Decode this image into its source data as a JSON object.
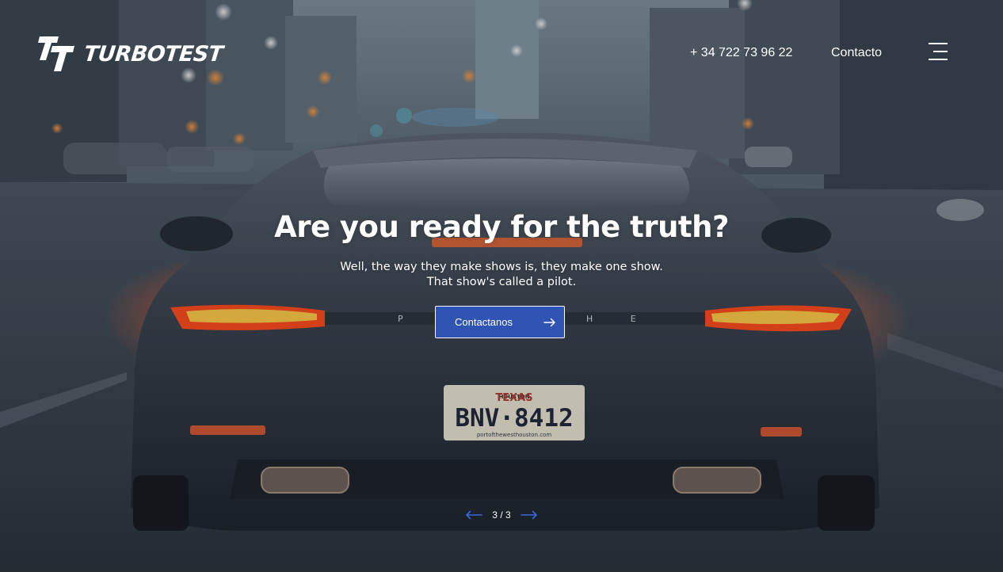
{
  "brand": {
    "name": "TURBOTEST",
    "accent_color": "#2f54b4"
  },
  "header": {
    "phone": "+ 34 722 73 96 22",
    "contact_label": "Contacto",
    "menu_icon": "hamburger-menu-icon"
  },
  "hero": {
    "title": "Are you ready for the truth?",
    "subtitle_line1": "Well, the way they make shows is, they make one show.",
    "subtitle_line2": "That show's called a pilot.",
    "cta_label": "Contactanos",
    "cta_icon": "arrow-right-icon"
  },
  "slider": {
    "current": "3",
    "separator": "/",
    "total": "3",
    "prev_icon": "arrow-left-icon",
    "next_icon": "arrow-right-icon"
  },
  "background_image": {
    "plate_state": "TEXAS",
    "plate_number": "BNV·8412",
    "plate_top": "HOUSTON",
    "plate_bottom": "portofthewesthouston.com"
  }
}
